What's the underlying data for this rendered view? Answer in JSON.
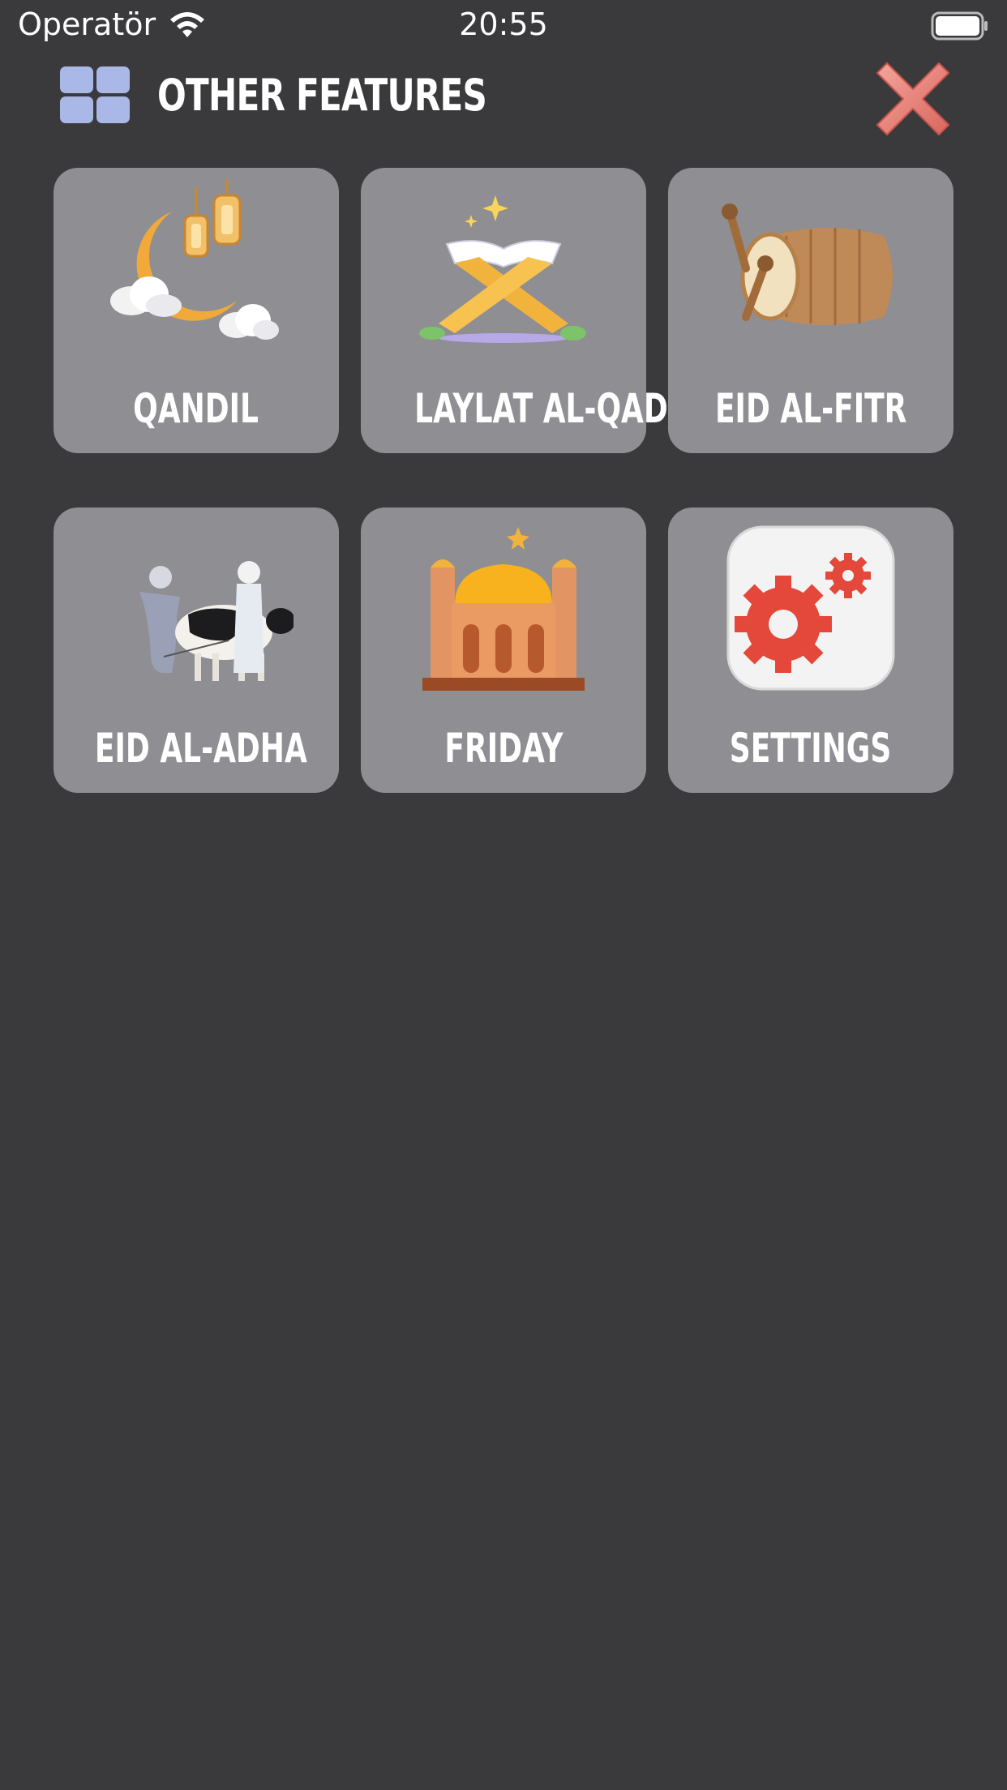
{
  "status_bar": {
    "carrier": "Operatör",
    "time": "20:55"
  },
  "header": {
    "title": "OTHER FEATURES",
    "menu_icon": "grid-menu-icon",
    "close_icon": "close-x-icon"
  },
  "features": [
    {
      "label": "QANDIL",
      "icon": "crescent-lanterns-icon"
    },
    {
      "label": "LAYLAT AL-QADR",
      "icon": "quran-stand-icon"
    },
    {
      "label": "EID AL-FITR",
      "icon": "drum-icon"
    },
    {
      "label": "EID AL-ADHA",
      "icon": "people-cow-icon"
    },
    {
      "label": "FRIDAY",
      "icon": "mosque-icon"
    },
    {
      "label": "SETTINGS",
      "icon": "gears-icon"
    }
  ],
  "colors": {
    "background": "#3a3a3d",
    "tile": "#8e8e93",
    "grid_icon": "#a9b8e6",
    "close": "#e57a72"
  }
}
